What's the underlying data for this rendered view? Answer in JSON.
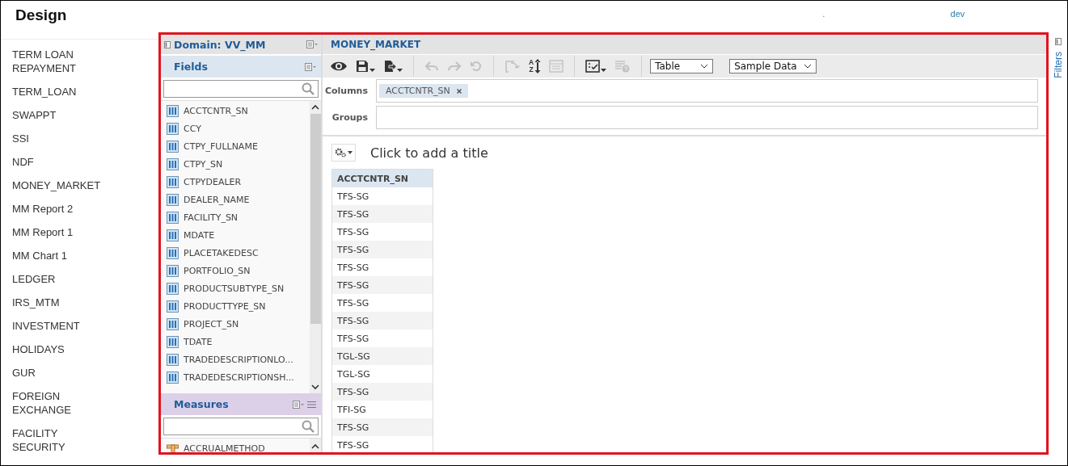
{
  "header": {
    "title": "Design",
    "mark": ".",
    "user": "dev"
  },
  "nav": {
    "items": [
      {
        "label": "TERM LOAN REPAYMENT"
      },
      {
        "label": "TERM_LOAN"
      },
      {
        "label": "SWAPPT"
      },
      {
        "label": "SSI"
      },
      {
        "label": "NDF"
      },
      {
        "label": "MONEY_MARKET"
      },
      {
        "label": "MM Report 2"
      },
      {
        "label": "MM Report 1"
      },
      {
        "label": "MM Chart 1"
      },
      {
        "label": "LEDGER"
      },
      {
        "label": "IRS_MTM"
      },
      {
        "label": "INVESTMENT"
      },
      {
        "label": "HOLIDAYS"
      },
      {
        "label": "GUR"
      },
      {
        "label": "FOREIGN EXCHANGE"
      },
      {
        "label": "FACILITY SECURITY"
      }
    ]
  },
  "domain": {
    "title": "Domain: VV_MM"
  },
  "fields": {
    "title": "Fields",
    "items": [
      "ACCTCNTR_SN",
      "CCY",
      "CTPY_FULLNAME",
      "CTPY_SN",
      "CTPYDEALER",
      "DEALER_NAME",
      "FACILITY_SN",
      "MDATE",
      "PLACETAKEDESC",
      "PORTFOLIO_SN",
      "PRODUCTSUBTYPE_SN",
      "PRODUCTTYPE_SN",
      "PROJECT_SN",
      "TDATE",
      "TRADEDESCRIPTIONLO...",
      "TRADEDESCRIPTIONSH..."
    ]
  },
  "measures": {
    "title": "Measures",
    "items": [
      "ACCRUALMETHOD"
    ]
  },
  "report": {
    "title": "MONEY_MARKET",
    "toolbar": [
      [
        {
          "kind": "view",
          "disabled": false,
          "menu": false
        },
        {
          "kind": "save",
          "disabled": false,
          "menu": true
        },
        {
          "kind": "export",
          "disabled": false,
          "menu": true
        }
      ],
      [
        {
          "kind": "undo",
          "disabled": true,
          "menu": false
        },
        {
          "kind": "redo",
          "disabled": true,
          "menu": false
        },
        {
          "kind": "reset",
          "disabled": true,
          "menu": false
        }
      ],
      [
        {
          "kind": "swap",
          "disabled": true,
          "menu": false
        },
        {
          "kind": "sort",
          "disabled": false,
          "menu": false,
          "letters": [
            "A",
            "Z"
          ]
        },
        {
          "kind": "layout",
          "disabled": true,
          "menu": false
        }
      ],
      [
        {
          "kind": "select",
          "disabled": false,
          "menu": true
        },
        {
          "kind": "filter",
          "disabled": true,
          "menu": false
        }
      ]
    ],
    "view_select": {
      "value": "Table"
    },
    "data_select": {
      "value": "Sample Data"
    },
    "columns": {
      "label": "Columns",
      "chips": [
        "ACCTCNTR_SN"
      ]
    },
    "groups": {
      "label": "Groups"
    },
    "title_placeholder": "Click to add a title",
    "table": {
      "columns": [
        "ACCTCNTR_SN"
      ],
      "rows": [
        [
          "TFS-SG"
        ],
        [
          "TFS-SG"
        ],
        [
          "TFS-SG"
        ],
        [
          "TFS-SG"
        ],
        [
          "TFS-SG"
        ],
        [
          "TFS-SG"
        ],
        [
          "TFS-SG"
        ],
        [
          "TFS-SG"
        ],
        [
          "TFS-SG"
        ],
        [
          "TGL-SG"
        ],
        [
          "TGL-SG"
        ],
        [
          "TFS-SG"
        ],
        [
          "TFI-SG"
        ],
        [
          "TFS-SG"
        ],
        [
          "TFS-SG"
        ]
      ]
    }
  },
  "filters": {
    "label": "Filters"
  }
}
